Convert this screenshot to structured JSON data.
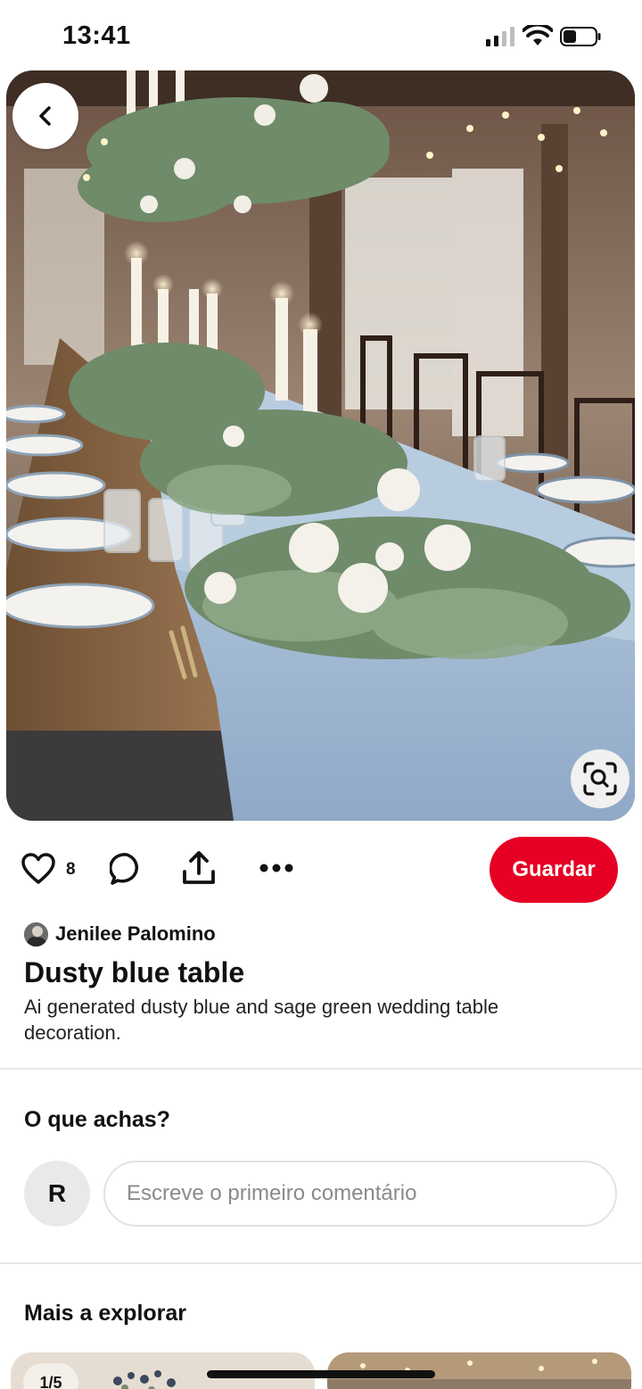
{
  "status_bar": {
    "time": "13:41"
  },
  "hero": {
    "image_description_icon": "wedding-table-image",
    "back_icon": "chevron-left-icon",
    "lens_icon": "visual-search-icon"
  },
  "actions": {
    "like_count": "8",
    "save_label": "Guardar",
    "save_color": "#e60023"
  },
  "pin": {
    "author": "Jenilee Palomino",
    "title": "Dusty blue table",
    "description": "Ai generated dusty blue and sage green wedding table decoration."
  },
  "comments": {
    "heading": "O que achas?",
    "user_initial": "R",
    "placeholder": "Escreve o primeiro comentário"
  },
  "explore": {
    "heading": "Mais a explorar",
    "first_card_badge": "1/5"
  },
  "colors": {
    "accent": "#e60023",
    "tablecloth": "#9fb7d3",
    "greenery": "#6f8b6a"
  }
}
